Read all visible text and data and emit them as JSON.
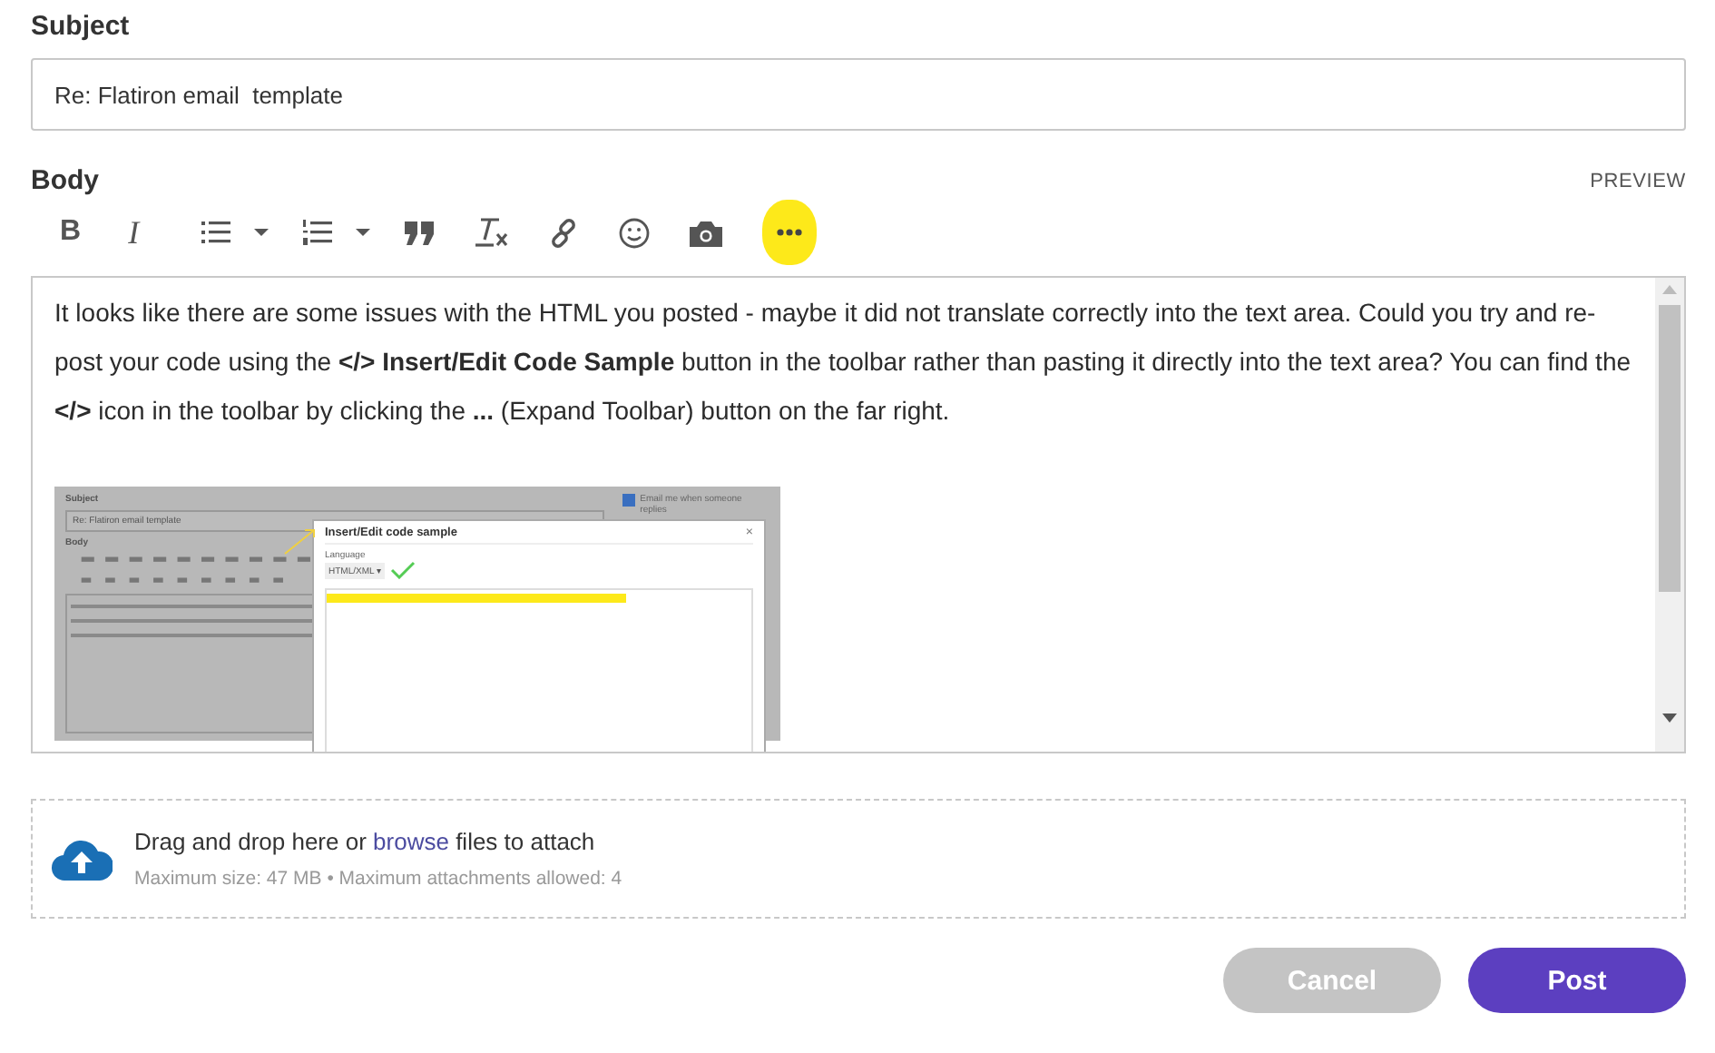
{
  "subject": {
    "label": "Subject",
    "value": "Re: Flatiron email  template"
  },
  "body": {
    "label": "Body",
    "preview": "PREVIEW",
    "toolbar": [
      {
        "kind": "bold",
        "label": "B"
      },
      {
        "kind": "italic",
        "label": "I"
      },
      {
        "kind": "bullets"
      },
      {
        "kind": "caret"
      },
      {
        "kind": "numbered"
      },
      {
        "kind": "caret"
      },
      {
        "kind": "quote"
      },
      {
        "kind": "clear"
      },
      {
        "kind": "link"
      },
      {
        "kind": "emoji"
      },
      {
        "kind": "camera"
      },
      {
        "kind": "more"
      }
    ],
    "more_highlighted": true,
    "paragraph": "It looks like there are some issues with the HTML you posted - maybe it did not translate correctly into the text area. Could you try and re-post your code using the **</> Insert/Edit Code Sample** button in the toolbar rather than pasting it directly into the text area? You can find the **</>** icon in the toolbar by clicking the **...** (Expand Toolbar) button on the far right.",
    "screenshot": {
      "subject_label": "Subject",
      "subject_value": "Re: Flatiron email  template",
      "body_label": "Body",
      "notify": "Email me when someone replies",
      "notify_checked": true,
      "dialog_title": "Insert/Edit code sample",
      "dialog_close": "×",
      "language_label": "Language",
      "language_value": "HTML/XML ▾"
    }
  },
  "attachments": {
    "before": "Drag and drop here or ",
    "link": "browse",
    "after": " files to attach",
    "limits": "Maximum size: 47 MB • Maximum attachments allowed: 4"
  },
  "buttons": [
    {
      "label": "Cancel",
      "kind": "secondary",
      "disabled": true
    },
    {
      "label": "Post",
      "kind": "primary",
      "disabled": false
    }
  ]
}
